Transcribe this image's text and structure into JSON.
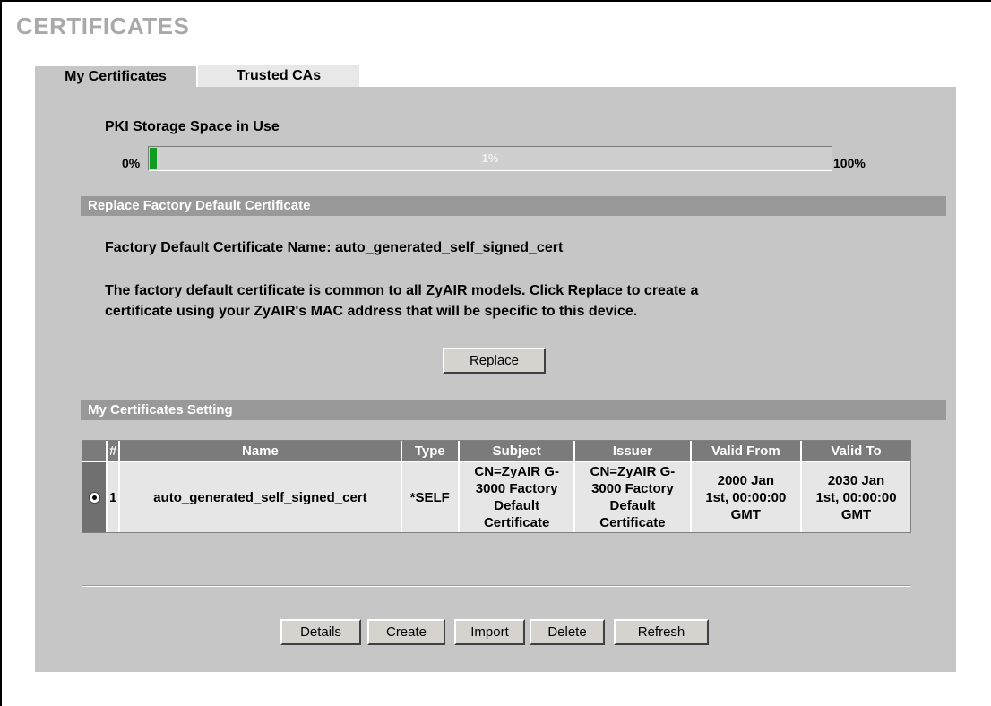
{
  "page_title": "CERTIFICATES",
  "tabs": [
    {
      "label": "My Certificates",
      "active": true
    },
    {
      "label": "Trusted CAs",
      "active": false
    }
  ],
  "pki": {
    "label": "PKI Storage Space in Use",
    "low_label": "0%",
    "high_label": "100%",
    "usage_text": "1%",
    "usage_fraction": 0.01,
    "fill_color": "#119b23"
  },
  "replace_section": {
    "header": "Replace Factory Default Certificate",
    "cert_name_line": "Factory Default Certificate Name: auto_generated_self_signed_cert",
    "description_line1": "The factory default certificate is common to all ZyAIR models. Click Replace to create a",
    "description_line2": "certificate using your ZyAIR's MAC address that will be specific to this device.",
    "replace_button": "Replace"
  },
  "settings_section": {
    "header": "My Certificates Setting",
    "table": {
      "headers": [
        "",
        "#",
        "Name",
        "Type",
        "Subject",
        "Issuer",
        "Valid From",
        "Valid To"
      ],
      "rows": [
        {
          "selected": true,
          "index": "1",
          "name": "auto_generated_self_signed_cert",
          "type": "*SELF",
          "subject": [
            "CN=ZyAIR G-",
            "3000 Factory",
            "Default",
            "Certificate"
          ],
          "issuer": [
            "CN=ZyAIR G-",
            "3000 Factory",
            "Default",
            "Certificate"
          ],
          "valid_from": [
            "2000 Jan",
            "1st, 00:00:00",
            "GMT"
          ],
          "valid_to": [
            "2030 Jan",
            "1st, 00:00:00",
            "GMT"
          ]
        }
      ]
    }
  },
  "buttons": {
    "details": "Details",
    "create": "Create",
    "import": "Import",
    "delete": "Delete",
    "refresh": "Refresh"
  }
}
